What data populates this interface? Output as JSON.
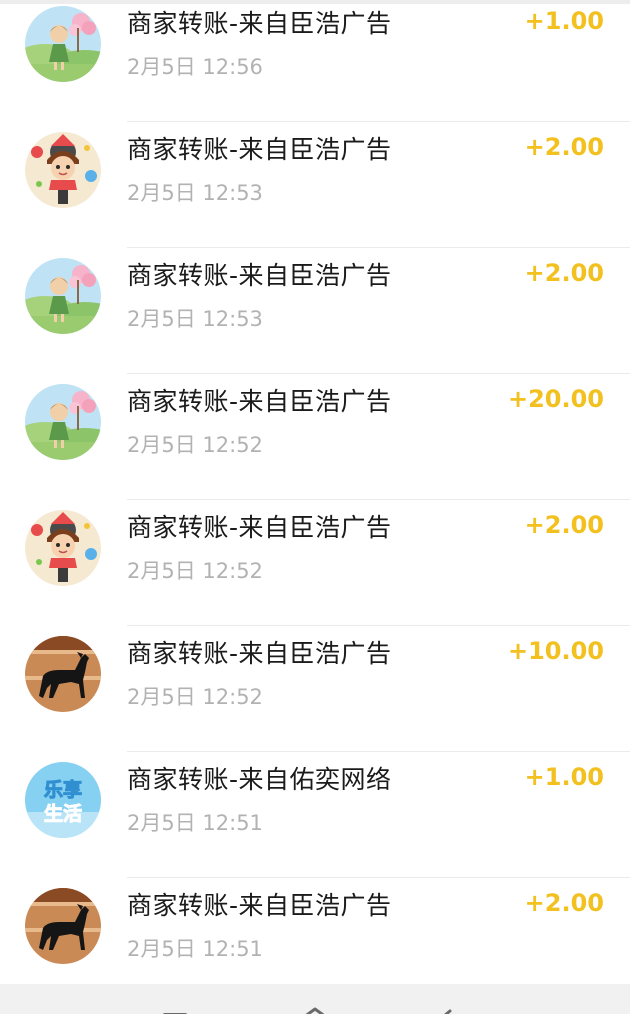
{
  "transactions": [
    {
      "title": "商家转账-来自臣浩广告",
      "time": "2月5日 12:56",
      "amount": "+1.00",
      "avatar": "fairy-girl-icon"
    },
    {
      "title": "商家转账-来自臣浩广告",
      "time": "2月5日 12:53",
      "amount": "+2.00",
      "avatar": "karaoke-girl-icon"
    },
    {
      "title": "商家转账-来自臣浩广告",
      "time": "2月5日 12:53",
      "amount": "+2.00",
      "avatar": "fairy-girl-icon"
    },
    {
      "title": "商家转账-来自臣浩广告",
      "time": "2月5日 12:52",
      "amount": "+20.00",
      "avatar": "fairy-girl-icon"
    },
    {
      "title": "商家转账-来自臣浩广告",
      "time": "2月5日 12:52",
      "amount": "+2.00",
      "avatar": "karaoke-girl-icon"
    },
    {
      "title": "商家转账-来自臣浩广告",
      "time": "2月5日 12:52",
      "amount": "+10.00",
      "avatar": "black-horse-icon"
    },
    {
      "title": "商家转账-来自佑奕网络",
      "time": "2月5日 12:51",
      "amount": "+1.00",
      "avatar": "lexiang-shenghuo-logo"
    },
    {
      "title": "商家转账-来自臣浩广告",
      "time": "2月5日 12:51",
      "amount": "+2.00",
      "avatar": "black-horse-icon"
    }
  ],
  "avatar_text": {
    "lexiang": "乐享",
    "shenghuo": "生活"
  },
  "colors": {
    "amount": "#f2c01f",
    "title": "#1b1b1b",
    "time": "#b2b2b2",
    "divider": "#ebebeb",
    "nav_bar": "#f1f1f1"
  },
  "nav_bar": {
    "buttons": [
      "menu-icon",
      "home-icon",
      "back-icon"
    ]
  }
}
